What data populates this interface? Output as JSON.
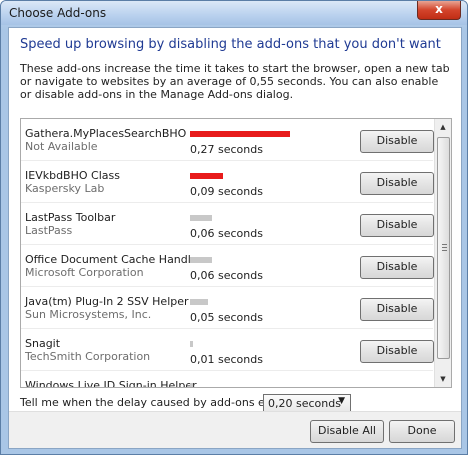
{
  "window": {
    "title": "Choose Add-ons",
    "close_label": "x"
  },
  "headline": "Speed up browsing by disabling the add-ons that you don't want",
  "description": "These add-ons increase the time it takes to start the browser, open a new tab or navigate to websites by an average of 0,55 seconds. You can also enable or disable add-ons in the Manage Add-ons dialog.",
  "addons": [
    {
      "name": "Gathera.MyPlacesSearchBHO",
      "publisher": "Not Available",
      "time": "0,27 seconds",
      "bar_fraction": 1.0,
      "bar_color": "#e81b1b",
      "button": "Disable"
    },
    {
      "name": "IEVkbdBHO Class",
      "publisher": "Kaspersky Lab",
      "time": "0,09 seconds",
      "bar_fraction": 0.33,
      "bar_color": "#e81b1b",
      "button": "Disable"
    },
    {
      "name": "LastPass Toolbar",
      "publisher": "LastPass",
      "time": "0,06 seconds",
      "bar_fraction": 0.22,
      "bar_color": "#c8c8c8",
      "button": "Disable"
    },
    {
      "name": "Office Document Cache Handler",
      "publisher": "Microsoft Corporation",
      "time": "0,06 seconds",
      "bar_fraction": 0.22,
      "bar_color": "#c8c8c8",
      "button": "Disable"
    },
    {
      "name": "Java(tm) Plug-In 2 SSV Helper",
      "publisher": "Sun Microsystems, Inc.",
      "time": "0,05 seconds",
      "bar_fraction": 0.18,
      "bar_color": "#c8c8c8",
      "button": "Disable"
    },
    {
      "name": "Snagit",
      "publisher": "TechSmith Corporation",
      "time": "0,01 seconds",
      "bar_fraction": 0.03,
      "bar_color": "#c8c8c8",
      "button": "Disable"
    },
    {
      "name": "Windows Live ID Sign-in Helper",
      "publisher": "",
      "time": "",
      "bar_fraction": 0.03,
      "bar_color": "#c8c8c8",
      "button": ""
    }
  ],
  "delay": {
    "label": "Tell me when the delay caused by add-ons exceeds:",
    "selected": "0,20 seconds"
  },
  "footer": {
    "disable_all": "Disable All",
    "done": "Done"
  }
}
